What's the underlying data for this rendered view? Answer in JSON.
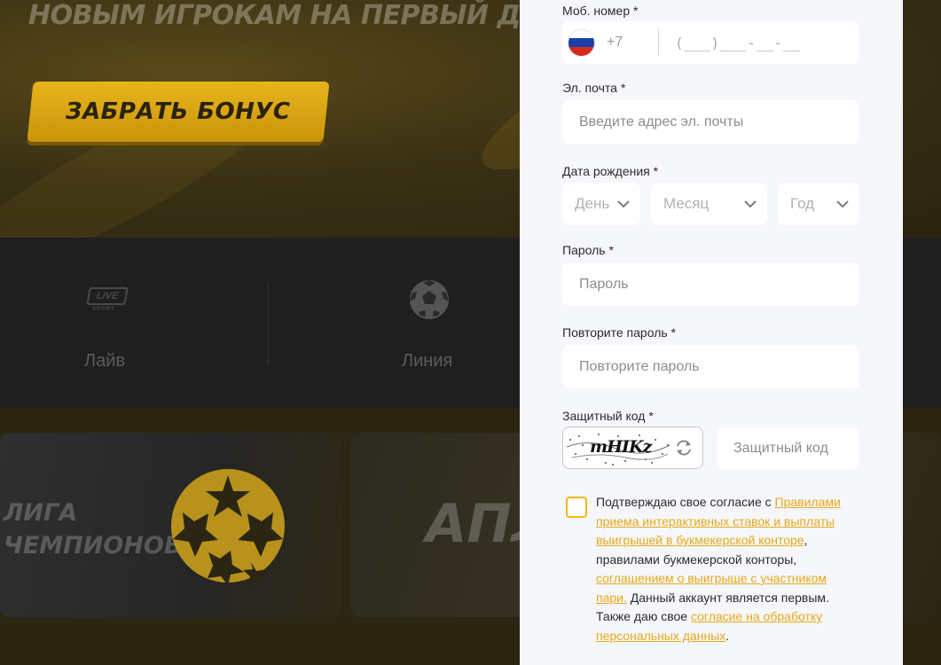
{
  "hero": {
    "title": "НОВЫМ ИГРОКАМ НА ПЕРВЫЙ ДЕПОЗИТ",
    "bonus_button": "ЗАБРАТЬ БОНУС"
  },
  "nav": {
    "live_badge": "LIVE",
    "live_sport": "SPORT",
    "items": [
      {
        "label": "Лайв",
        "icon": "live-sport-icon"
      },
      {
        "label": "Линия",
        "icon": "soccer-ball-icon"
      }
    ]
  },
  "cards": [
    {
      "title_line1": "ЛИГА",
      "title_line2": "ЧЕМПИОНОВ",
      "icon": "champions-league-star-ball-icon"
    },
    {
      "title": "АПЛ"
    }
  ],
  "form": {
    "phone": {
      "label": "Моб. номер *",
      "country_icon": "russia-flag-icon",
      "prefix": "+7",
      "mask": "(___)___-__-__"
    },
    "email": {
      "label": "Эл. почта *",
      "placeholder": "Введите адрес эл. почты"
    },
    "birthdate": {
      "label": "Дата рождения *",
      "day": "День",
      "month": "Месяц",
      "year": "Год"
    },
    "password": {
      "label": "Пароль *",
      "placeholder": "Пароль"
    },
    "password_repeat": {
      "label": "Повторите пароль *",
      "placeholder": "Повторите пароль"
    },
    "captcha": {
      "label": "Защитный код *",
      "image_text": "mHIKz",
      "placeholder": "Защитный код"
    },
    "agreement": {
      "text_1": "Подтверждаю свое согласие с ",
      "link_1": "Правилами приема интерактивных ставок и выплаты выигрышей в букмекерской конторе",
      "text_2": ", правилами букмекерской конторы, ",
      "link_2": "соглашением о выигрыше с участником пари.",
      "text_3": " Данный аккаунт является первым. Также даю свое ",
      "link_3": "согласие на обработку персональных данных",
      "text_4": "."
    }
  },
  "colors": {
    "accent": "#f0b714",
    "link": "#e7a818",
    "panel_bg": "#f6f7fb",
    "page_bg": "#1d1c19"
  }
}
